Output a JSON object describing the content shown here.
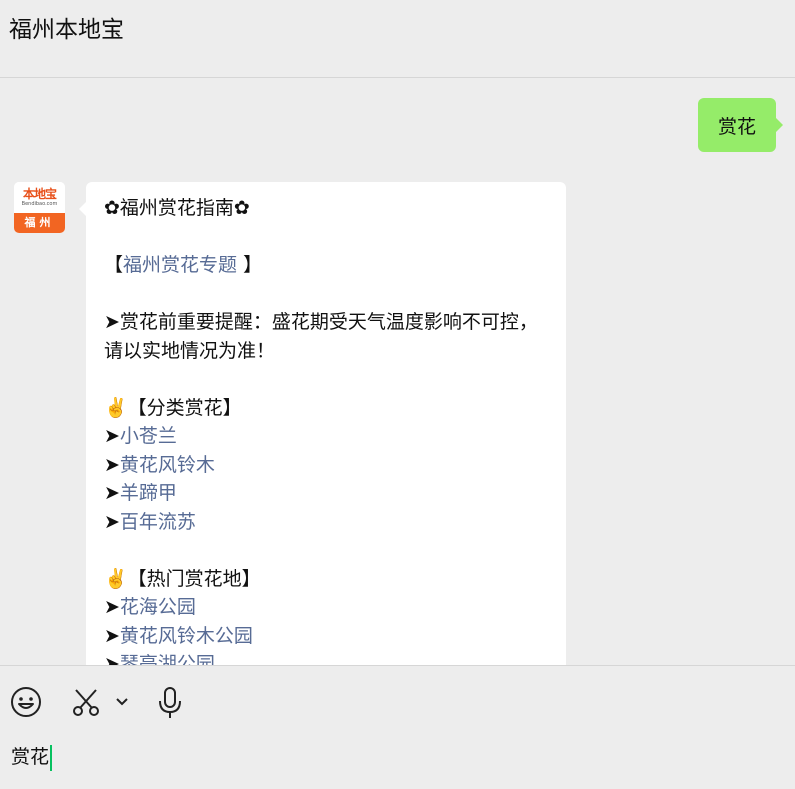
{
  "header": {
    "title": "福州本地宝"
  },
  "messages": {
    "sent": "赏花",
    "avatar": {
      "logo": "本地宝",
      "sub": "Bendibao.com",
      "city": "福州"
    },
    "guide": {
      "title": "✿福州赏花指南✿",
      "topic_open": "【",
      "topic_link": "福州赏花专题",
      "topic_close": " 】",
      "tip": "➤赏花前重要提醒：盛花期受天气温度影响不可控，请以实地情况为准！",
      "section1_title": "✌️【分类赏花】",
      "arrow": "➤",
      "section1_links": [
        "小苍兰",
        "黄花风铃木",
        "羊蹄甲",
        "百年流苏"
      ],
      "section2_title": "✌️【热门赏花地】",
      "section2_links": [
        "花海公园",
        "黄花风铃木公园",
        "琴亭湖公园"
      ]
    }
  },
  "toolbar": {
    "icons": [
      "emoji-icon",
      "scissors-icon",
      "chevron-down-icon",
      "microphone-icon"
    ]
  },
  "input": {
    "value": "赏花"
  }
}
